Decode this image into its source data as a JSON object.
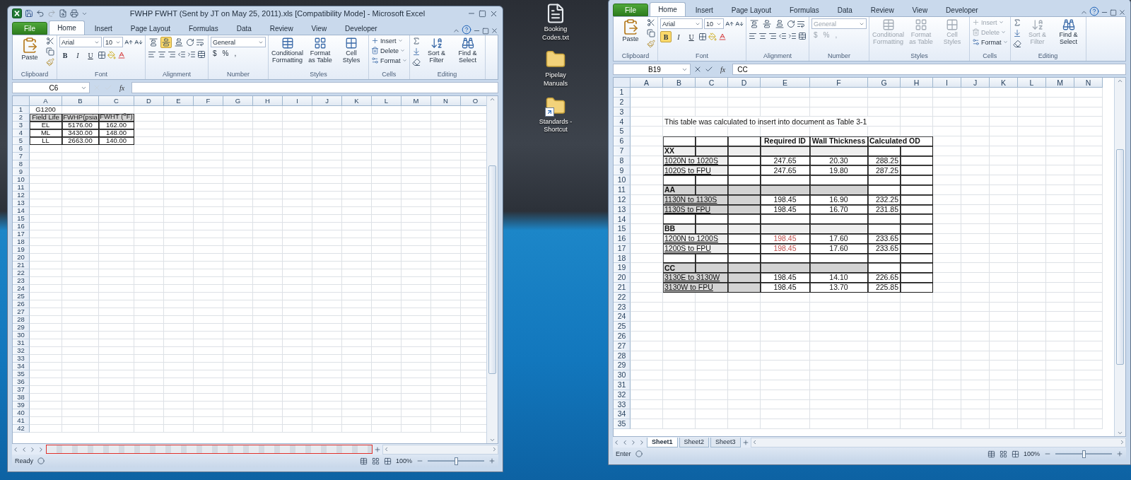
{
  "left_window": {
    "title": "FWHP  FWHT (Sent by JT on May 25, 2011).xls  [Compatibility Mode]  -  Microsoft Excel",
    "file_tab": "File",
    "tabs": [
      {
        "label": "Home",
        "selected": true
      },
      {
        "label": "Insert",
        "selected": false
      },
      {
        "label": "Page Layout",
        "selected": false
      },
      {
        "label": "Formulas",
        "selected": false
      },
      {
        "label": "Data",
        "selected": false
      },
      {
        "label": "Review",
        "selected": false
      },
      {
        "label": "View",
        "selected": false
      },
      {
        "label": "Developer",
        "selected": false
      }
    ],
    "ribbon": [
      {
        "kind": "clipboard",
        "label": "Clipboard",
        "button": "Paste"
      },
      {
        "kind": "font",
        "label": "Font",
        "font": "Arial",
        "size": "10",
        "toggles": [
          {
            "label": "B",
            "on": false
          },
          {
            "label": "I",
            "on": false
          },
          {
            "label": "U",
            "on": false
          }
        ]
      },
      {
        "kind": "alignment",
        "label": "Alignment",
        "vertical": [
          {
            "selected": false
          },
          {
            "selected": true
          },
          {
            "selected": false
          }
        ]
      },
      {
        "kind": "number",
        "label": "Number",
        "format": "General",
        "disabled": false,
        "symbols": [
          "$",
          "%",
          ","
        ]
      },
      {
        "kind": "styles",
        "label": "Styles",
        "items": [
          {
            "label": "Conditional Formatting",
            "disabled": false
          },
          {
            "label": "Format as Table",
            "disabled": false
          },
          {
            "label": "Cell Styles",
            "disabled": false
          }
        ]
      },
      {
        "kind": "cells",
        "label": "Cells",
        "items": [
          {
            "label": "Insert",
            "disabled": false
          },
          {
            "label": "Delete",
            "disabled": false
          },
          {
            "label": "Format",
            "disabled": false
          }
        ]
      },
      {
        "kind": "editing",
        "label": "Editing",
        "items": [
          {
            "label": "Sort & Filter",
            "disabled": false
          },
          {
            "label": "Find & Select",
            "disabled": false
          }
        ]
      }
    ],
    "name_box": "C6",
    "function_label": "fx",
    "editing": false,
    "columns": [
      "A",
      "B",
      "C",
      "D",
      "E",
      "F",
      "G",
      "H",
      "I",
      "J",
      "K",
      "L",
      "M",
      "N",
      "O"
    ],
    "rows": [
      {
        "label": "1",
        "cells": [
          {
            "text": "G1200",
            "kind": "center"
          }
        ]
      },
      {
        "label": "2",
        "cells": [
          {
            "text": "Field Life",
            "kind": "center",
            "framed": true,
            "shaded": true,
            "dark": true
          },
          {
            "text": "FWHP(psia",
            "kind": "center",
            "framed": true,
            "shaded": true,
            "dark": true
          },
          {
            "text": "FWHT ($^{o}$F)",
            "kind": "center",
            "framed": true,
            "shaded": true,
            "dark": true
          }
        ]
      },
      {
        "label": "3",
        "cells": [
          {
            "text": "EL",
            "kind": "center",
            "framed": true
          },
          {
            "text": "5176.00",
            "kind": "center",
            "framed": true
          },
          {
            "text": "162.00",
            "kind": "center",
            "framed": true
          }
        ]
      },
      {
        "label": "4",
        "cells": [
          {
            "text": "ML",
            "kind": "center",
            "framed": true
          },
          {
            "text": "3430.00",
            "kind": "center",
            "framed": true
          },
          {
            "text": "148.00",
            "kind": "center",
            "framed": true
          }
        ]
      },
      {
        "label": "5",
        "cells": [
          {
            "text": "LL",
            "kind": "center",
            "framed": true
          },
          {
            "text": "2663.00",
            "kind": "center",
            "framed": true
          },
          {
            "text": "140.00",
            "kind": "center",
            "framed": true
          }
        ]
      },
      {
        "label": "6"
      },
      {
        "label": "7"
      },
      {
        "label": "8"
      },
      {
        "label": "9"
      },
      {
        "label": "10"
      },
      {
        "label": "11"
      },
      {
        "label": "12"
      },
      {
        "label": "13"
      },
      {
        "label": "14"
      },
      {
        "label": "15"
      },
      {
        "label": "16"
      },
      {
        "label": "17"
      },
      {
        "label": "18"
      },
      {
        "label": "19"
      },
      {
        "label": "20"
      },
      {
        "label": "21"
      },
      {
        "label": "22"
      },
      {
        "label": "23"
      },
      {
        "label": "24"
      },
      {
        "label": "25"
      },
      {
        "label": "26"
      },
      {
        "label": "27"
      },
      {
        "label": "28"
      },
      {
        "label": "29"
      },
      {
        "label": "30"
      },
      {
        "label": "31"
      },
      {
        "label": "32"
      },
      {
        "label": "33"
      },
      {
        "label": "34"
      },
      {
        "label": "35"
      },
      {
        "label": "36"
      },
      {
        "label": "37"
      },
      {
        "label": "38"
      },
      {
        "label": "39"
      },
      {
        "label": "40"
      },
      {
        "label": "41"
      },
      {
        "label": "42"
      }
    ],
    "sheet_tabs_redacted": true,
    "status": "Ready",
    "zoom": "100%",
    "zoom_slider": {
      "level": 0.5
    }
  },
  "desktop_icons": [
    {
      "label": "Booking Codes.txt",
      "kind": "file"
    },
    {
      "label": "Pipelay Manuals",
      "kind": "folder"
    },
    {
      "label": "Standards - Shortcut",
      "kind": "shortcut"
    }
  ],
  "right_window": {
    "file_tab": "File",
    "tabs": [
      {
        "label": "Home",
        "selected": true
      },
      {
        "label": "Insert",
        "selected": false
      },
      {
        "label": "Page Layout",
        "selected": false
      },
      {
        "label": "Formulas",
        "selected": false
      },
      {
        "label": "Data",
        "selected": false
      },
      {
        "label": "Review",
        "selected": false
      },
      {
        "label": "View",
        "selected": false
      },
      {
        "label": "Developer",
        "selected": false
      }
    ],
    "ribbon": [
      {
        "kind": "clipboard",
        "label": "Clipboard",
        "button": "Paste"
      },
      {
        "kind": "font",
        "label": "Font",
        "font": "Arial",
        "size": "10",
        "toggles": [
          {
            "label": "B",
            "on": true
          },
          {
            "label": "I",
            "on": false
          },
          {
            "label": "U",
            "on": false
          }
        ]
      },
      {
        "kind": "alignment",
        "label": "Alignment",
        "vertical": [
          {
            "selected": false
          },
          {
            "selected": false
          },
          {
            "selected": false
          }
        ]
      },
      {
        "kind": "number",
        "label": "Number",
        "format": "General",
        "disabled": true,
        "symbols": [
          "$",
          "%",
          ","
        ]
      },
      {
        "kind": "styles",
        "label": "Styles",
        "items": [
          {
            "label": "Conditional Formatting",
            "disabled": true
          },
          {
            "label": "Format as Table",
            "disabled": true
          },
          {
            "label": "Cell Styles",
            "disabled": true
          }
        ]
      },
      {
        "kind": "cells",
        "label": "Cells",
        "items": [
          {
            "label": "Insert",
            "disabled": true
          },
          {
            "label": "Delete",
            "disabled": true
          },
          {
            "label": "Format",
            "disabled": false
          }
        ]
      },
      {
        "kind": "editing",
        "label": "Editing",
        "items": [
          {
            "label": "Sort & Filter",
            "disabled": true
          },
          {
            "label": "Find & Select",
            "disabled": false
          }
        ]
      }
    ],
    "name_box": "B19",
    "function_label": "fx",
    "editing": true,
    "formula": "CC",
    "columns": [
      "A",
      "B",
      "C",
      "D",
      "E",
      "F",
      "G",
      "H",
      "I",
      "J",
      "K",
      "L",
      "M",
      "N"
    ],
    "rows": [
      {
        "label": "1"
      },
      {
        "label": "2"
      },
      {
        "label": "3"
      },
      {
        "label": "4",
        "cells": [
          {},
          {
            "text": "This table was calculated to insert into document as Table 3-1",
            "kind": "text",
            "wide": true
          }
        ]
      },
      {
        "label": "5"
      },
      {
        "label": "6",
        "cells": [
          {},
          {
            "framed": true
          },
          {
            "framed": true
          },
          {
            "framed": true
          },
          {
            "text": "Required ID",
            "kind": "center",
            "bold": true,
            "framed": true
          },
          {
            "text": "Wall Thickness",
            "kind": "center",
            "bold": true,
            "framed": true
          },
          {
            "text": "Calculated OD",
            "kind": "text",
            "bold": true,
            "framed": true,
            "merged": true
          }
        ]
      },
      {
        "label": "7",
        "cells": [
          {},
          {
            "text": "XX",
            "kind": "text",
            "bold": true,
            "framed": true,
            "shaded": true
          },
          {
            "framed": true,
            "shaded": true
          },
          {
            "framed": true,
            "shaded": true
          },
          {
            "framed": true,
            "shaded": true
          },
          {
            "framed": true,
            "shaded": true
          },
          {
            "framed": true
          },
          {
            "framed": true
          }
        ]
      },
      {
        "label": "8",
        "cells": [
          {},
          {
            "text": "1020N to 1020S",
            "kind": "text",
            "underline": true,
            "framed": true,
            "shaded": true,
            "merged": true
          },
          {
            "framed": true
          },
          {
            "text": "247.65",
            "kind": "center",
            "framed": true
          },
          {
            "text": "20.30",
            "kind": "center",
            "framed": true
          },
          {
            "text": "288.25",
            "kind": "number",
            "framed": true
          },
          {
            "framed": true
          }
        ]
      },
      {
        "label": "9",
        "cells": [
          {},
          {
            "text": "1020S to FPU",
            "kind": "text",
            "underline": true,
            "framed": true,
            "shaded": true,
            "merged": true
          },
          {
            "framed": true
          },
          {
            "text": "247.65",
            "kind": "center",
            "framed": true
          },
          {
            "text": "19.80",
            "kind": "center",
            "framed": true
          },
          {
            "text": "287.25",
            "kind": "number",
            "framed": true
          },
          {
            "framed": true
          }
        ]
      },
      {
        "label": "10",
        "cells": [
          {},
          {
            "framed": true
          },
          {
            "framed": true
          },
          {
            "framed": true
          },
          {
            "framed": true
          },
          {
            "framed": true
          },
          {
            "framed": true
          },
          {
            "framed": true
          }
        ]
      },
      {
        "label": "11",
        "cells": [
          {},
          {
            "text": "AA",
            "kind": "text",
            "bold": true,
            "framed": true,
            "shaded": true,
            "dark": true
          },
          {
            "framed": true,
            "shaded": true,
            "dark": true
          },
          {
            "framed": true,
            "shaded": true,
            "dark": true
          },
          {
            "framed": true,
            "shaded": true,
            "dark": true
          },
          {
            "framed": true,
            "shaded": true,
            "dark": true
          },
          {
            "framed": true
          },
          {
            "framed": true
          }
        ]
      },
      {
        "label": "12",
        "cells": [
          {},
          {
            "text": "1130N to 1130S",
            "kind": "text",
            "underline": true,
            "framed": true,
            "shaded": true,
            "dark": true,
            "merged": true
          },
          {
            "framed": true,
            "shaded": true,
            "dark": true
          },
          {
            "text": "198.45",
            "kind": "center",
            "framed": true
          },
          {
            "text": "16.90",
            "kind": "center",
            "framed": true
          },
          {
            "text": "232.25",
            "kind": "number",
            "framed": true
          },
          {
            "framed": true
          }
        ]
      },
      {
        "label": "13",
        "cells": [
          {},
          {
            "text": "1130S to FPU",
            "kind": "text",
            "underline": true,
            "framed": true,
            "shaded": true,
            "dark": true,
            "merged": true
          },
          {
            "framed": true,
            "shaded": true,
            "dark": true
          },
          {
            "text": "198.45",
            "kind": "center",
            "framed": true
          },
          {
            "text": "16.70",
            "kind": "center",
            "framed": true
          },
          {
            "text": "231.85",
            "kind": "number",
            "framed": true
          },
          {
            "framed": true
          }
        ]
      },
      {
        "label": "14",
        "cells": [
          {},
          {
            "framed": true
          },
          {
            "framed": true
          },
          {
            "framed": true
          },
          {
            "framed": true
          },
          {
            "framed": true
          },
          {
            "framed": true
          },
          {
            "framed": true
          }
        ]
      },
      {
        "label": "15",
        "cells": [
          {},
          {
            "text": "BB",
            "kind": "text",
            "bold": true,
            "framed": true,
            "shaded": true
          },
          {
            "framed": true,
            "shaded": true
          },
          {
            "framed": true,
            "shaded": true
          },
          {
            "framed": true,
            "shaded": true
          },
          {
            "framed": true,
            "shaded": true
          },
          {
            "framed": true
          },
          {
            "framed": true
          }
        ]
      },
      {
        "label": "16",
        "cells": [
          {},
          {
            "text": "1200N to 1200S",
            "kind": "text",
            "underline": true,
            "framed": true,
            "shaded": true,
            "merged": true
          },
          {
            "framed": true
          },
          {
            "text": "198.45",
            "kind": "center",
            "framed": true,
            "color": "#c0504d"
          },
          {
            "text": "17.60",
            "kind": "center",
            "framed": true
          },
          {
            "text": "233.65",
            "kind": "number",
            "framed": true
          },
          {
            "framed": true
          }
        ]
      },
      {
        "label": "17",
        "cells": [
          {},
          {
            "text": "1200S to FPU",
            "kind": "text",
            "underline": true,
            "framed": true,
            "shaded": true,
            "merged": true
          },
          {
            "framed": true
          },
          {
            "text": "198.45",
            "kind": "center",
            "framed": true,
            "color": "#c0504d"
          },
          {
            "text": "17.60",
            "kind": "center",
            "framed": true
          },
          {
            "text": "233.65",
            "kind": "number",
            "framed": true
          },
          {
            "framed": true
          }
        ]
      },
      {
        "label": "18",
        "cells": [
          {},
          {
            "framed": true
          },
          {
            "framed": true
          },
          {
            "framed": true
          },
          {
            "framed": true
          },
          {
            "framed": true
          },
          {
            "framed": true
          },
          {
            "framed": true
          }
        ]
      },
      {
        "label": "19",
        "cells": [
          {},
          {
            "text": "CC",
            "kind": "text",
            "bold": true,
            "framed": true,
            "shaded": true,
            "dark": true
          },
          {
            "framed": true,
            "shaded": true,
            "dark": true
          },
          {
            "framed": true,
            "shaded": true,
            "dark": true
          },
          {
            "framed": true,
            "shaded": true,
            "dark": true
          },
          {
            "framed": true,
            "shaded": true,
            "dark": true
          },
          {
            "framed": true
          },
          {
            "framed": true
          }
        ]
      },
      {
        "label": "20",
        "cells": [
          {},
          {
            "text": "3130E to 3130W",
            "kind": "text",
            "underline": true,
            "framed": true,
            "shaded": true,
            "dark": true,
            "merged": true
          },
          {
            "framed": true,
            "shaded": true,
            "dark": true
          },
          {
            "text": "198.45",
            "kind": "center",
            "framed": true
          },
          {
            "text": "14.10",
            "kind": "center",
            "framed": true
          },
          {
            "text": "226.65",
            "kind": "number",
            "framed": true
          },
          {
            "framed": true
          }
        ]
      },
      {
        "label": "21",
        "cells": [
          {},
          {
            "text": "3130W to FPU",
            "kind": "text",
            "underline": true,
            "framed": true,
            "shaded": true,
            "dark": true,
            "merged": true
          },
          {
            "framed": true,
            "shaded": true,
            "dark": true
          },
          {
            "text": "198.45",
            "kind": "center",
            "framed": true
          },
          {
            "text": "13.70",
            "kind": "center",
            "framed": true
          },
          {
            "text": "225.85",
            "kind": "number",
            "framed": true
          },
          {
            "framed": true
          }
        ]
      },
      {
        "label": "22"
      },
      {
        "label": "23"
      },
      {
        "label": "24"
      },
      {
        "label": "25"
      },
      {
        "label": "26"
      },
      {
        "label": "27"
      },
      {
        "label": "28"
      },
      {
        "label": "29"
      },
      {
        "label": "30"
      },
      {
        "label": "31"
      },
      {
        "label": "32"
      },
      {
        "label": "33"
      },
      {
        "label": "34"
      },
      {
        "label": "35"
      }
    ],
    "sheet_tabs": [
      {
        "label": "Sheet1",
        "selected": true
      },
      {
        "label": "Sheet2",
        "selected": false
      },
      {
        "label": "Sheet3",
        "selected": false
      }
    ],
    "status": "Enter",
    "zoom": "100%",
    "zoom_slider": {
      "level": 0.5
    }
  }
}
